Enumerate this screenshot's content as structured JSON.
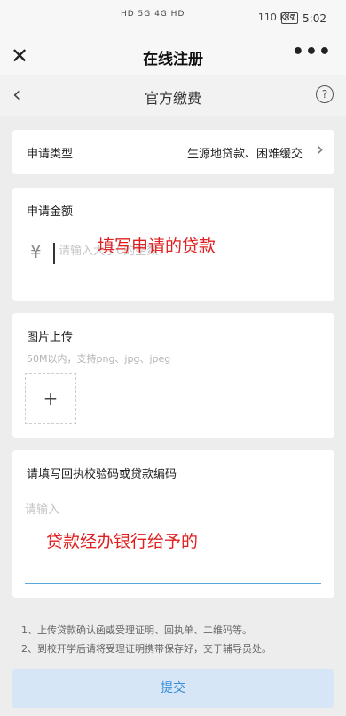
{
  "status_bar": {
    "left_indicators": "HD 5G 4G HD",
    "net_speed": "110 K/s",
    "battery": "87",
    "time": "5:02"
  },
  "navbar": {
    "close_glyph": "✕",
    "title": "在线注册",
    "more_glyph": "•••"
  },
  "subheader": {
    "back_glyph": "‹",
    "title": "官方缴费",
    "help_glyph": "?"
  },
  "application_type": {
    "label": "申请类型",
    "value": "生源地贷款、困难缓交",
    "chevron_glyph": "›"
  },
  "amount": {
    "label": "申请金额",
    "currency": "¥",
    "placeholder": "请输入大于0的整数",
    "annotation": "填写申请的贷款"
  },
  "image_upload": {
    "label": "图片上传",
    "hint": "50M以内，支持png、jpg、jpeg",
    "add_glyph": "+"
  },
  "code": {
    "label": "请填写回执校验码或贷款编码",
    "placeholder": "请输入",
    "annotation": "贷款经办银行给予的"
  },
  "notes": [
    "1、上传贷款确认函或受理证明、回执单、二维码等。",
    "2、到校开学后请将受理证明携带保存好，交于辅导员处。"
  ],
  "submit_label": "提交",
  "colors": {
    "accent_blue": "#3a8fd6",
    "annotation_red": "#e02020",
    "page_bg": "#ededed"
  }
}
